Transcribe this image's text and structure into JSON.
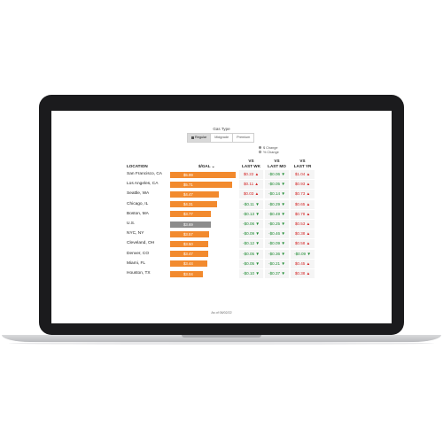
{
  "filter": {
    "title": "Gas Type",
    "tabs": [
      {
        "label": "Regular",
        "active": true
      },
      {
        "label": "Midgrade",
        "active": false
      },
      {
        "label": "Premium",
        "active": false
      }
    ],
    "radio_options": [
      {
        "label": "$ Change",
        "selected": true
      },
      {
        "label": "% Change",
        "selected": false
      }
    ]
  },
  "table": {
    "headers": {
      "location": "LOCATION",
      "price": "$/GAL",
      "wk": [
        "VS",
        "LAST WK"
      ],
      "mo": [
        "VS",
        "LAST MO"
      ],
      "yr": [
        "VS",
        "LAST YR"
      ]
    },
    "rows": [
      {
        "location": "San Francisco, CA",
        "price": "$5.99",
        "wk": "$0.22 ▲",
        "mo": "-$0.06 ▼",
        "yr": "$1.04 ▲",
        "wk_up": true,
        "mo_up": false,
        "yr_up": true
      },
      {
        "location": "Los Angeles, CA",
        "price": "$5.71",
        "wk": "$0.11 ▲",
        "mo": "-$0.05 ▼",
        "yr": "$0.93 ▲",
        "wk_up": true,
        "mo_up": false,
        "yr_up": true
      },
      {
        "location": "Seattle, WA",
        "price": "$4.47",
        "wk": "$0.03 ▲",
        "mo": "-$0.14 ▼",
        "yr": "$0.73 ▲",
        "wk_up": true,
        "mo_up": false,
        "yr_up": true
      },
      {
        "location": "Chicago, IL",
        "price": "$4.31",
        "wk": "-$0.11 ▼",
        "mo": "-$0.29 ▼",
        "yr": "$0.65 ▲",
        "wk_up": false,
        "mo_up": false,
        "yr_up": true
      },
      {
        "location": "Boston, MA",
        "price": "$3.77",
        "wk": "-$0.13 ▼",
        "mo": "-$0.49 ▼",
        "yr": "$0.78 ▲",
        "wk_up": false,
        "mo_up": false,
        "yr_up": true
      },
      {
        "location": "U.S.",
        "price": "$3.69",
        "wk": "-$0.06 ▼",
        "mo": "-$0.25 ▼",
        "yr": "$0.53 ▲",
        "wk_up": false,
        "mo_up": false,
        "yr_up": true,
        "highlight": true
      },
      {
        "location": "NYC, NY",
        "price": "$3.57",
        "wk": "-$0.09 ▼",
        "mo": "-$0.46 ▼",
        "yr": "$0.38 ▲",
        "wk_up": false,
        "mo_up": false,
        "yr_up": true
      },
      {
        "location": "Cleveland, OH",
        "price": "$3.50",
        "wk": "-$0.12 ▼",
        "mo": "-$0.09 ▼",
        "yr": "$0.58 ▲",
        "wk_up": false,
        "mo_up": false,
        "yr_up": true
      },
      {
        "location": "Denver, CO",
        "price": "$3.47",
        "wk": "-$0.05 ▼",
        "mo": "-$0.36 ▼",
        "yr": "-$0.09 ▼",
        "wk_up": false,
        "mo_up": false,
        "yr_up": false
      },
      {
        "location": "Miami, FL",
        "price": "$3.44",
        "wk": "-$0.05 ▼",
        "mo": "-$0.21 ▼",
        "yr": "$0.45 ▲",
        "wk_up": false,
        "mo_up": false,
        "yr_up": true
      },
      {
        "location": "Houston, TX",
        "price": "$3.04",
        "wk": "-$0.10 ▼",
        "mo": "-$0.37 ▼",
        "yr": "$0.38 ▲",
        "wk_up": false,
        "mo_up": false,
        "yr_up": true
      }
    ]
  },
  "bar_scale_max": 6.0,
  "as_of": "As of 06/02/22",
  "colors": {
    "bar": "#f28a2e",
    "bar_us": "#8c8c8c",
    "up": "#d42a2a",
    "down": "#1e8b32"
  }
}
